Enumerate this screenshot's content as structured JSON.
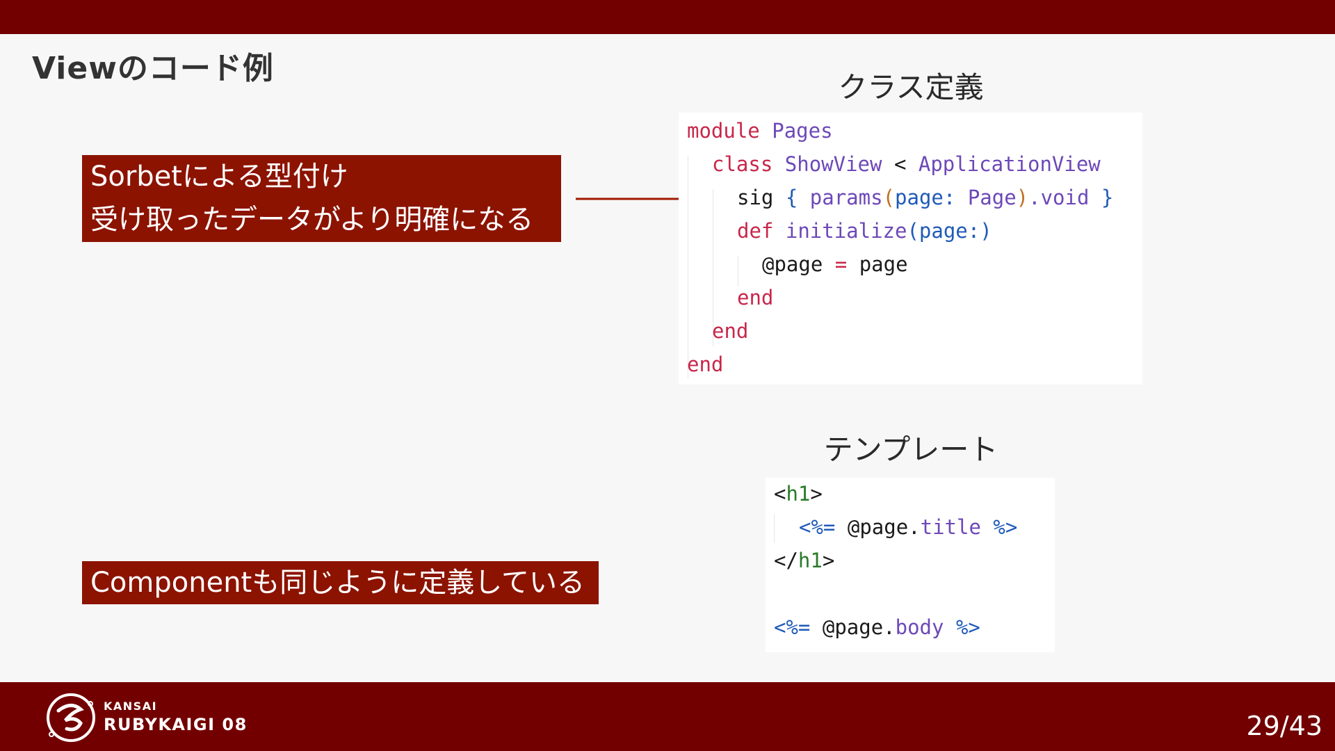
{
  "slide": {
    "title": "Viewのコード例",
    "page_number": "29/43"
  },
  "captions": {
    "class_definition": "クラス定義",
    "template": "テンプレート"
  },
  "callouts": {
    "sorbet": [
      "Sorbetによる型付け",
      "受け取ったデータがより明確になる"
    ],
    "component": "Componentも同じように定義している"
  },
  "code_class": {
    "module_kw": "module",
    "module_name": "Pages",
    "class_kw": "class",
    "class_name": "ShowView",
    "lt": "<",
    "superclass": "ApplicationView",
    "sig": "sig",
    "brace_open": "{",
    "params": "params",
    "paren_open": "(",
    "arg_label": "page:",
    "arg_type": "Page",
    "paren_close": ")",
    "void": ".void",
    "brace_close": "}",
    "def_kw": "def",
    "def_name": "initialize",
    "def_args": "(page:)",
    "ivar": "@page",
    "assign": "=",
    "rhs": "page",
    "end": "end"
  },
  "code_template": {
    "h1_open_lt": "<",
    "h1_tag": "h1",
    "h1_open_gt": ">",
    "erb_open": "<%=",
    "title_recv": "@page",
    "dot": ".",
    "title_meth": "title",
    "erb_close": "%>",
    "h1_close_lt": "</",
    "h1_close_gt": ">",
    "body_recv": "@page",
    "body_meth": "body"
  },
  "footer": {
    "brand_small": "KANSAI",
    "brand_large": "RUBYKAIGI 08"
  },
  "colors": {
    "bar": "#730000",
    "callout": "#8c1300",
    "background": "#f7f7f7",
    "keyword": "#c8264a",
    "constant": "#6d48b8",
    "erb": "#1f5ab8",
    "html_tag": "#2a7a2a"
  }
}
